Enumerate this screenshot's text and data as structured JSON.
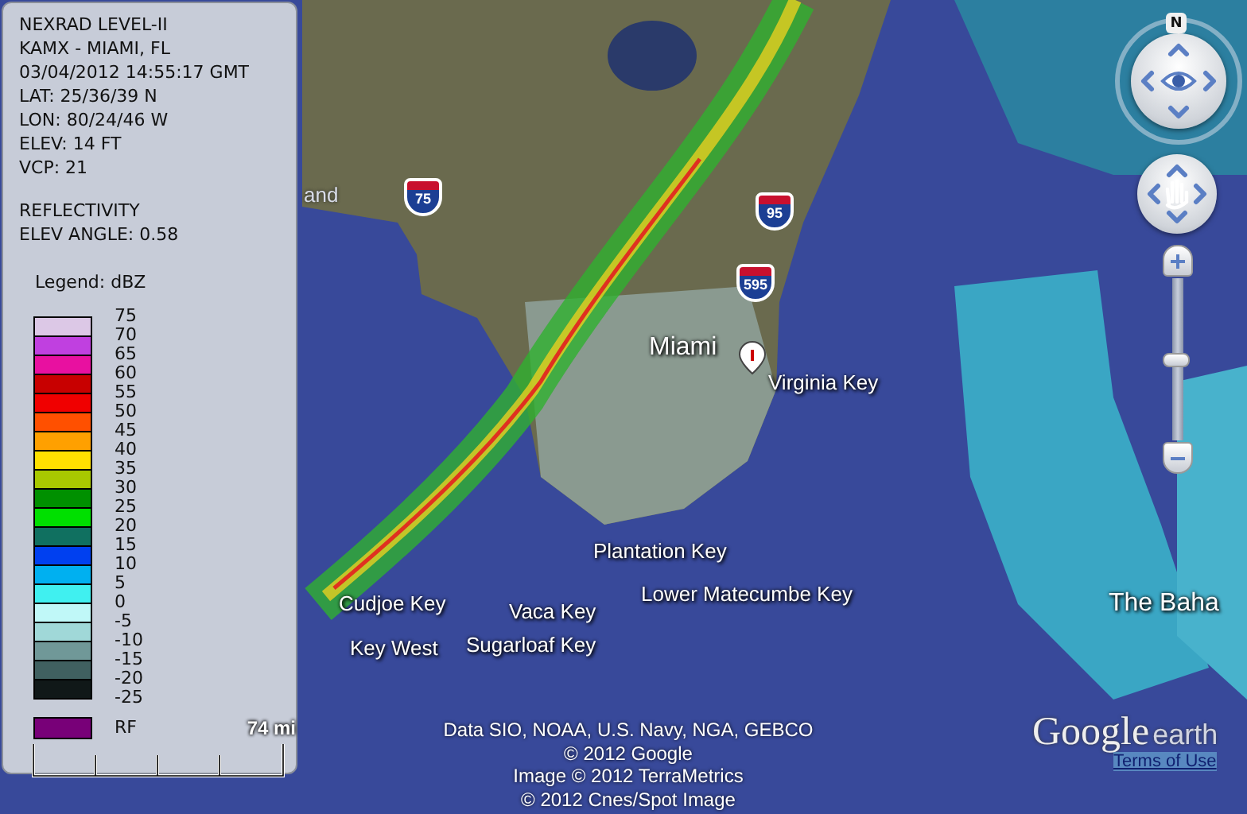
{
  "panel": {
    "header_lines": [
      "NEXRAD LEVEL-II",
      "KAMX - MIAMI, FL",
      "03/04/2012 14:55:17 GMT",
      "LAT: 25/36/39 N",
      "LON: 80/24/46 W",
      "ELEV: 14 FT",
      "VCP: 21"
    ],
    "product_lines": [
      "REFLECTIVITY",
      "ELEV ANGLE: 0.58"
    ],
    "legend_title": "Legend: dBZ",
    "legend_labels": [
      "75",
      "70",
      "65",
      "60",
      "55",
      "50",
      "45",
      "40",
      "35",
      "30",
      "25",
      "20",
      "15",
      "10",
      "5",
      "0",
      "-5",
      "-10",
      "-15",
      "-20",
      "-25"
    ],
    "legend_colors": [
      {
        "color": "#dcc8e6"
      },
      {
        "color": "#c040e0"
      },
      {
        "color": "#e810a0"
      },
      {
        "color": "#c80000"
      },
      {
        "color": "#f00000"
      },
      {
        "color": "#ff5000"
      },
      {
        "color": "#ffa000"
      },
      {
        "color": "#ffe000"
      },
      {
        "color": "#a8c800"
      },
      {
        "color": "#009000"
      },
      {
        "color": "#00e000"
      },
      {
        "color": "#107060"
      },
      {
        "color": "#0040f0"
      },
      {
        "color": "#00b0f0"
      },
      {
        "color": "#40f0f0"
      },
      {
        "color": "#c0f8f8"
      },
      {
        "color": "#a0d8d8"
      },
      {
        "color": "#709898"
      },
      {
        "color": "#406060"
      },
      {
        "color": "#101818"
      }
    ],
    "rf": {
      "label": "RF",
      "color": "#780078"
    },
    "scale_label": "74 mi"
  },
  "map": {
    "labels": [
      {
        "text": "and"
      },
      {
        "text": "Miami"
      },
      {
        "text": "Virginia Key"
      },
      {
        "text": "Plantation Key"
      },
      {
        "text": "Lower Matecumbe Key"
      },
      {
        "text": "Cudjoe Key"
      },
      {
        "text": "Vaca Key"
      },
      {
        "text": "Key West"
      },
      {
        "text": "Sugarloaf Key"
      },
      {
        "text": "The Baha"
      }
    ],
    "shields": [
      "75",
      "95",
      "595"
    ],
    "attribution": [
      "Data SIO, NOAA, U.S. Navy, NGA, GEBCO",
      "© 2012 Google",
      "Image © 2012 TerraMetrics",
      "© 2012 Cnes/Spot Image"
    ],
    "logo": {
      "word_1": "Google",
      "word_2": "earth"
    },
    "terms_link": "Terms of Use"
  },
  "nav": {
    "north": "N"
  }
}
